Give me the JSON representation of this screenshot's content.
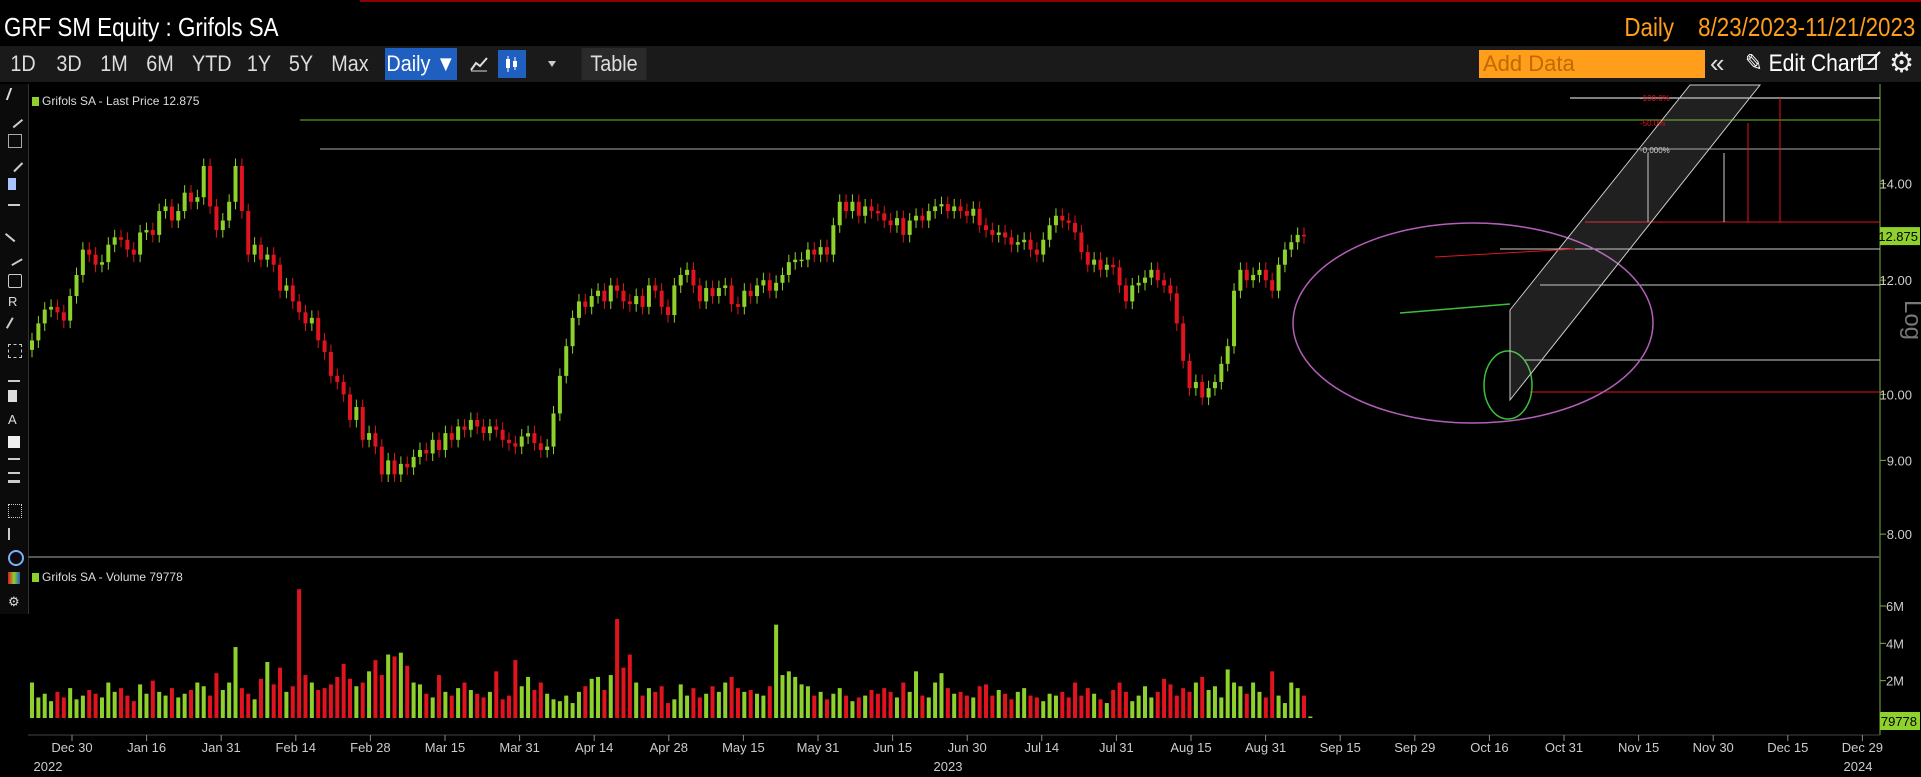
{
  "header": {
    "ticker_title": "GRF SM Equity : Grifols SA",
    "frequency": "Daily",
    "date_range": "8/23/2023-11/21/2023"
  },
  "toolbar": {
    "periods": [
      "1D",
      "3D",
      "1M",
      "6M",
      "YTD",
      "1Y",
      "5Y",
      "Max"
    ],
    "frequency_label": "Daily ▼",
    "table_label": "Table",
    "add_data_placeholder": "Add Data",
    "edit_chart_label": "Edit Chart"
  },
  "legend": {
    "price": "Grifols SA - Last Price 12.875",
    "volume": "Grifols SA - Volume 79778"
  },
  "scale_label": "Log",
  "colors": {
    "up": "#8fd12c",
    "down": "#e0141e",
    "accent": "#ff9e1b",
    "select": "#1f5fbf"
  },
  "chart_data": [
    {
      "type": "candlestick",
      "title": "",
      "series_name": "Grifols SA - Last Price",
      "last_price": 12.875,
      "y_scale": "log",
      "ylim": [
        7.8,
        16.0
      ],
      "y_ticks": [
        "8.00",
        "9.00",
        "10.00",
        "12.00",
        "14.00"
      ],
      "last_price_label": "12.875",
      "x_tick_labels": [
        "Dec 30",
        "Jan 16",
        "Jan 31",
        "Feb 14",
        "Feb 28",
        "Mar 15",
        "Mar 31",
        "Apr 14",
        "Apr 28",
        "May 15",
        "May 31",
        "Jun 15",
        "Jun 30",
        "Jul 14",
        "Jul 31",
        "Aug 15",
        "Aug 31",
        "Sep 15",
        "Sep 29",
        "Oct 16",
        "Oct 31",
        "Nov 15",
        "Nov 30",
        "Dec 15",
        "Dec 29"
      ],
      "year_labels": [
        "2022",
        "2023",
        "2024"
      ],
      "closes": [
        10.9,
        11.2,
        11.45,
        11.5,
        11.4,
        11.25,
        11.7,
        12.1,
        12.6,
        12.5,
        12.3,
        12.35,
        12.7,
        12.85,
        12.8,
        12.6,
        12.5,
        12.95,
        13.0,
        12.9,
        13.4,
        13.5,
        13.2,
        13.4,
        13.8,
        13.6,
        13.7,
        14.4,
        13.5,
        13.0,
        13.2,
        13.6,
        14.4,
        13.4,
        12.5,
        12.7,
        12.4,
        12.5,
        12.3,
        11.8,
        11.9,
        11.6,
        11.4,
        11.2,
        11.3,
        10.9,
        10.7,
        10.3,
        10.2,
        10.0,
        9.6,
        9.8,
        9.3,
        9.4,
        9.2,
        8.8,
        9.0,
        8.8,
        8.95,
        8.9,
        9.05,
        9.15,
        9.1,
        9.3,
        9.15,
        9.4,
        9.3,
        9.5,
        9.45,
        9.6,
        9.5,
        9.4,
        9.5,
        9.45,
        9.3,
        9.25,
        9.2,
        9.35,
        9.4,
        9.25,
        9.15,
        9.2,
        9.7,
        10.3,
        10.8,
        11.3,
        11.6,
        11.5,
        11.7,
        11.8,
        11.6,
        11.9,
        11.8,
        11.6,
        11.55,
        11.7,
        11.5,
        11.9,
        11.8,
        11.5,
        11.35,
        11.9,
        12.1,
        12.2,
        11.9,
        11.6,
        11.85,
        11.7,
        11.85,
        11.9,
        11.55,
        11.5,
        11.8,
        11.7,
        11.9,
        12.0,
        11.8,
        11.95,
        12.1,
        12.35,
        12.4,
        12.4,
        12.6,
        12.5,
        12.65,
        12.5,
        13.1,
        13.6,
        13.4,
        13.6,
        13.3,
        13.5,
        13.4,
        13.35,
        13.2,
        13.1,
        13.25,
        12.9,
        13.2,
        13.3,
        13.2,
        13.4,
        13.5,
        13.55,
        13.4,
        13.5,
        13.4,
        13.3,
        13.45,
        13.1,
        13.0,
        12.9,
        12.95,
        12.85,
        12.7,
        12.75,
        12.8,
        12.6,
        12.5,
        12.8,
        13.1,
        13.3,
        13.2,
        13.15,
        12.95,
        12.55,
        12.3,
        12.4,
        12.2,
        12.3,
        12.25,
        11.9,
        11.6,
        11.9,
        11.95,
        12.05,
        12.2,
        12.0,
        11.9,
        11.75,
        11.2,
        10.55,
        10.1,
        10.2,
        9.95,
        10.1,
        10.2,
        10.5,
        10.8,
        11.8,
        12.2,
        12.0,
        12.1,
        12.2,
        12.0,
        11.8,
        12.3,
        12.6,
        12.75,
        12.9,
        12.875
      ]
    },
    {
      "type": "bar",
      "title": "",
      "series_name": "Grifols SA - Volume",
      "last_volume": 79778,
      "y_ticks": [
        "2M",
        "4M",
        "6M"
      ],
      "ylim": [
        0,
        7500000
      ],
      "last_volume_label": "79778",
      "values_millions": [
        1.9,
        1.1,
        1.3,
        0.9,
        1.4,
        1.1,
        1.6,
        1.0,
        1.2,
        1.5,
        1.3,
        1.1,
        1.9,
        1.4,
        1.6,
        1.2,
        0.9,
        1.8,
        1.3,
        2.0,
        1.4,
        1.2,
        1.6,
        1.1,
        1.3,
        1.5,
        1.9,
        1.7,
        1.2,
        2.4,
        1.5,
        1.9,
        3.8,
        1.6,
        1.3,
        1.0,
        2.1,
        3.0,
        1.8,
        2.7,
        1.4,
        1.7,
        6.9,
        2.3,
        1.9,
        1.5,
        1.6,
        1.8,
        2.2,
        2.9,
        2.1,
        1.7,
        1.9,
        2.5,
        3.1,
        2.3,
        3.4,
        3.3,
        3.5,
        2.8,
        1.9,
        1.8,
        1.3,
        1.1,
        2.3,
        1.4,
        1.2,
        1.6,
        1.9,
        1.5,
        1.3,
        1.1,
        1.4,
        2.5,
        1.0,
        1.2,
        3.1,
        1.7,
        2.2,
        1.5,
        1.9,
        1.3,
        1.0,
        0.9,
        1.2,
        0.8,
        1.4,
        1.7,
        2.1,
        2.2,
        1.5,
        2.3,
        5.3,
        2.7,
        3.4,
        1.9,
        1.2,
        1.6,
        1.4,
        1.7,
        0.8,
        1.0,
        1.8,
        1.2,
        1.6,
        1.1,
        1.3,
        1.7,
        1.4,
        1.9,
        2.2,
        1.6,
        1.4,
        1.5,
        1.3,
        1.2,
        1.7,
        5.0,
        2.3,
        2.5,
        2.2,
        1.8,
        1.7,
        1.2,
        1.4,
        1.0,
        1.3,
        1.6,
        1.2,
        0.9,
        1.1,
        1.2,
        1.5,
        1.3,
        1.6,
        1.4,
        1.1,
        1.9,
        1.4,
        2.5,
        1.2,
        1.1,
        1.9,
        2.4,
        1.6,
        1.3,
        1.4,
        1.2,
        1.1,
        1.7,
        1.8,
        1.2,
        1.5,
        1.3,
        1.0,
        1.4,
        1.6,
        1.2,
        1.1,
        0.9,
        1.3,
        1.2,
        1.4,
        1.1,
        1.9,
        1.2,
        1.6,
        1.3,
        1.0,
        0.8,
        1.5,
        1.9,
        1.4,
        0.9,
        1.2,
        1.7,
        1.1,
        1.4,
        2.1,
        1.8,
        1.2,
        1.6,
        1.4,
        1.9,
        2.2,
        1.5,
        1.7,
        1.1,
        2.6,
        1.9,
        1.7,
        1.3,
        1.9,
        1.4,
        1.1,
        2.5,
        1.2,
        0.8,
        1.9,
        1.6,
        1.2,
        0.08
      ]
    }
  ],
  "overlays": {
    "fib_percent_labels": [
      "-100.0%",
      "-50.0%",
      "-0.000%"
    ]
  }
}
